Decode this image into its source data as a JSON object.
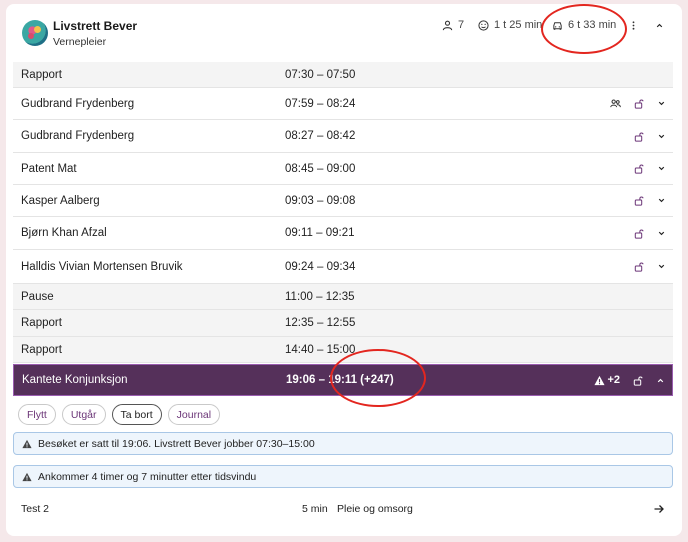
{
  "header": {
    "name": "Livstrett Bever",
    "role": "Vernepleier",
    "stats": {
      "persons": "7",
      "wait": "1 t 25 min",
      "drive": "6 t 33 min"
    }
  },
  "rows": [
    {
      "label": "Rapport",
      "time": "07:30  –  07:50"
    },
    {
      "label": "Gudbrand Frydenberg",
      "time": "07:59  –  08:24"
    },
    {
      "label": "Gudbrand Frydenberg",
      "time": "08:27  –  08:42"
    },
    {
      "label": "Patent Mat",
      "time": "08:45  –  09:00"
    },
    {
      "label": "Kasper Aalberg",
      "time": "09:03  –  09:08"
    },
    {
      "label": "Bjørn Khan Afzal",
      "time": "09:11  –  09:21"
    },
    {
      "label": "Halldis Vivian Mortensen Bruvik",
      "time": "09:24  –  09:34"
    },
    {
      "label": "Pause",
      "time": "11:00  –  12:35"
    },
    {
      "label": "Rapport",
      "time": "12:35  –  12:55"
    },
    {
      "label": "Rapport",
      "time": "14:40  –  15:00"
    },
    {
      "label": "Kantete Konjunksjon",
      "time": "19:06  –  19:11 (+247)",
      "warn_count": "+2"
    }
  ],
  "chips": [
    "Flytt",
    "Utgår",
    "Ta bort",
    "Journal"
  ],
  "notices": [
    "Besøket er satt til 19:06. Livstrett Bever jobber 07:30–15:00",
    "Ankommer 4 timer og 7 minutter etter tidsvindu"
  ],
  "footer": {
    "task": "Test 2",
    "duration": "5 min",
    "category": "Pleie og omsorg"
  },
  "colors": {
    "selected_row": "#55305a",
    "accent": "#6b3577",
    "notice_border": "#a9c7e6",
    "annotation": "#e3261f"
  }
}
